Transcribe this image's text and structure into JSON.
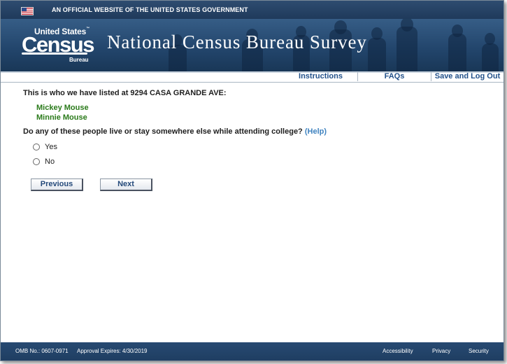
{
  "gov_banner": {
    "text": "AN OFFICIAL WEBSITE OF THE UNITED STATES GOVERNMENT",
    "flag_icon": "us-flag-icon"
  },
  "header": {
    "logo": {
      "top": "United States",
      "tm": "™",
      "main": "Census",
      "bottom": "Bureau"
    },
    "title": "National Census Bureau Survey"
  },
  "nav": {
    "instructions": "Instructions",
    "faqs": "FAQs",
    "save_logout": "Save and Log Out"
  },
  "main": {
    "intro": "This is who we have listed at 9294 CASA GRANDE AVE:",
    "people": [
      "Mickey Mouse",
      "Minnie Mouse"
    ],
    "question": "Do any of these people live or stay somewhere else while attending college?",
    "help": "(Help)",
    "options": [
      "Yes",
      "No"
    ],
    "previous": "Previous",
    "next": "Next"
  },
  "footer": {
    "omb": "OMB No.: 0607-0971",
    "expires": "Approval Expires: 4/30/2019",
    "accessibility": "Accessibility",
    "privacy": "Privacy",
    "security": "Security"
  },
  "colors": {
    "banner": "#1f3a5b",
    "person_name": "#2a7a1a",
    "link": "#22518a",
    "help_link": "#3f83c0"
  }
}
